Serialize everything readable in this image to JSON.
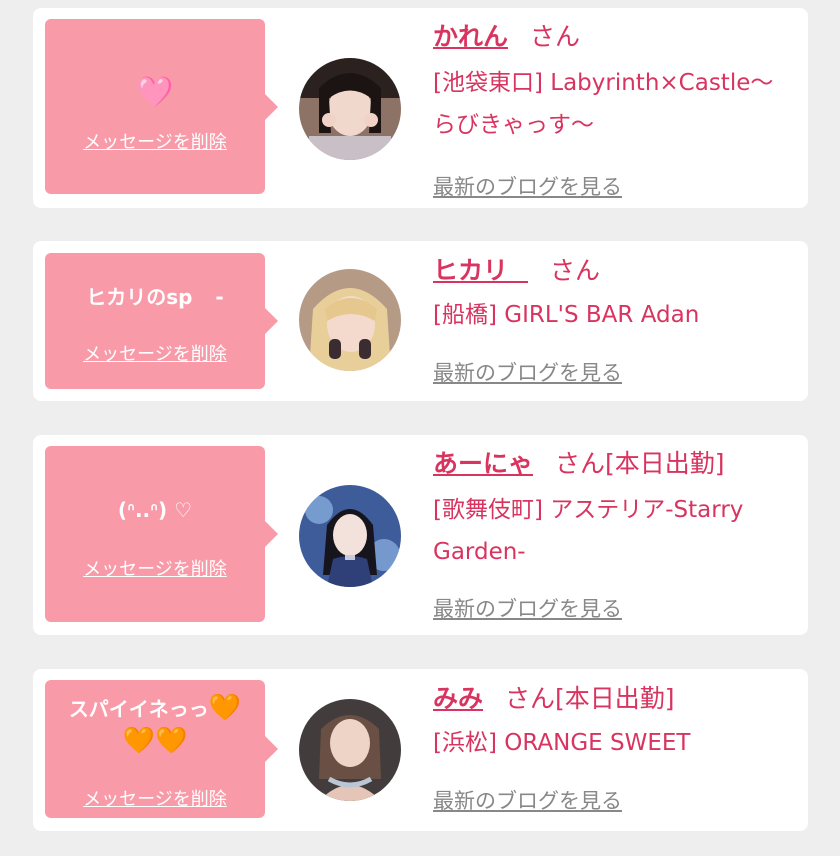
{
  "items": [
    {
      "message": "🩷",
      "delete_label": "メッセージを削除",
      "name": "かれん",
      "suffix": "さん",
      "shop": "[池袋東口] Labyrinth×Castle〜らびきゃっす〜",
      "blog_label": "最新のブログを見る",
      "avatar_icon": "profile-photo"
    },
    {
      "message": "ヒカリのsp -",
      "delete_label": "メッセージを削除",
      "name": "ヒカリ",
      "suffix": "さん",
      "shop": "[船橋] GIRL'S BAR Adan",
      "blog_label": "最新のブログを見る",
      "avatar_icon": "profile-photo"
    },
    {
      "message": "(ᐢ..ᐢ) ♡",
      "delete_label": "メッセージを削除",
      "name": "あーにゃ",
      "suffix": "さん[本日出勤]",
      "shop": "[歌舞伎町] アステリア-Starry Garden-",
      "blog_label": "最新のブログを見る",
      "avatar_icon": "profile-photo"
    },
    {
      "message_text": "スパイイネっっ",
      "message_hearts_1": "🧡",
      "message_hearts_2": "🧡🧡",
      "delete_label": "メッセージを削除",
      "name": "みみ",
      "suffix": "さん[本日出勤]",
      "shop": "[浜松] ORANGE SWEET",
      "blog_label": "最新のブログを見る",
      "avatar_icon": "profile-photo"
    }
  ],
  "colors": {
    "accent": "#d8345f",
    "bubble": "#f99aa9",
    "link_gray": "#888888",
    "background": "#eeeeee"
  }
}
